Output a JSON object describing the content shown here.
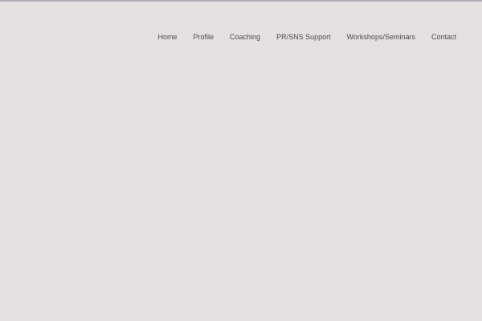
{
  "site": {
    "top_border_color": "#b6a8b7",
    "background_color": "#e5e0e0",
    "nav_text_color": "#4f4a4a"
  },
  "nav": {
    "items": [
      {
        "label": "Home"
      },
      {
        "label": "Profile"
      },
      {
        "label": "Coaching"
      },
      {
        "label": "PR/SNS Support"
      },
      {
        "label": "Workshops/Seminars"
      },
      {
        "label": "Contact"
      }
    ]
  }
}
